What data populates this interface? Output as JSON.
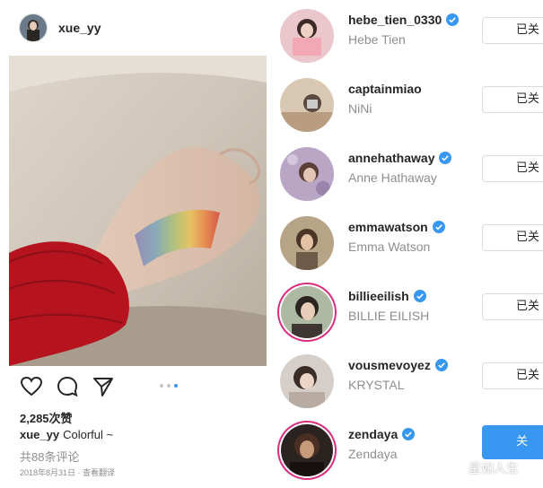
{
  "post": {
    "username": "xue_yy",
    "likes": "2,285次赞",
    "caption_user": "xue_yy",
    "caption_text": "Colorful ~",
    "comments_link": "共88条评论",
    "meta": "2018年8月31日 · 查看翻译",
    "carousel": {
      "count": 3,
      "active_index": 2
    },
    "icons": [
      "heart-icon",
      "comment-icon",
      "share-icon"
    ]
  },
  "following": [
    {
      "username": "hebe_tien_0330",
      "full_name": "Hebe Tien",
      "verified": true,
      "button": "已关"
    },
    {
      "username": "captainmiao",
      "full_name": "NiNi",
      "verified": false,
      "button": "已关"
    },
    {
      "username": "annehathaway",
      "full_name": "Anne Hathaway",
      "verified": true,
      "button": "已关"
    },
    {
      "username": "emmawatson",
      "full_name": "Emma Watson",
      "verified": true,
      "button": "已关"
    },
    {
      "username": "billieeilish",
      "full_name": "BILLIE EILISH",
      "verified": true,
      "button": "已关"
    },
    {
      "username": "vousmevoyez",
      "full_name": "KRYSTAL",
      "verified": true,
      "button": "已关"
    },
    {
      "username": "zendaya",
      "full_name": "Zendaya",
      "verified": true,
      "button": "关"
    }
  ],
  "watermark": "星如人生",
  "colors": {
    "accent": "#3897f0",
    "verified": "#3897f0",
    "story_ring": "#d8307f"
  }
}
